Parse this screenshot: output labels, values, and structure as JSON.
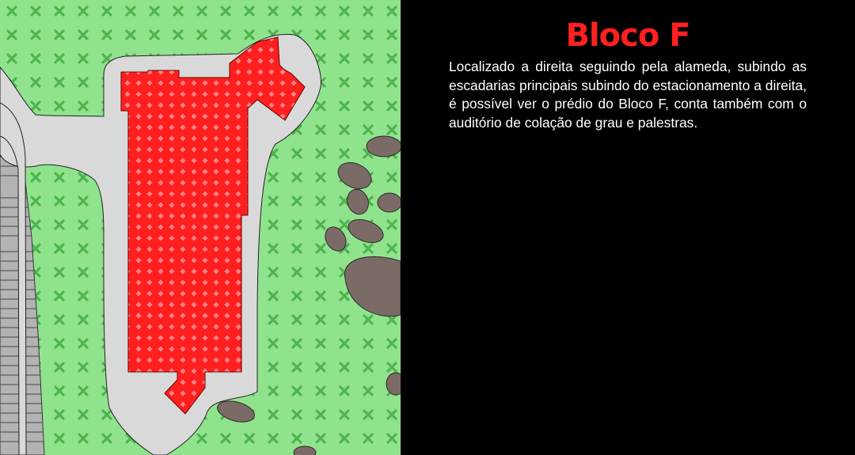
{
  "info": {
    "title": "Bloco F",
    "description": "Localizado a direita seguindo pela alameda, subindo as escadarias principais subindo do estacionamento a direita, é possível ver o prédio do Bloco F, conta também com o auditório de colação de grau e pal­estras."
  },
  "colors": {
    "grass": "#90e38d",
    "grass_pattern": "#4fb44f",
    "pavement": "#d9d9d9",
    "parking": "#b3b3b3",
    "building": "#ff1f1f",
    "building_pattern": "#ff8585",
    "rock": "#7a6b66",
    "title": "#ff2020",
    "text": "#ffffff",
    "background": "#000000"
  },
  "map": {
    "highlighted_building": "building-f",
    "features": [
      "grass",
      "walkway",
      "parking-lot",
      "building-f",
      "rocks"
    ]
  }
}
